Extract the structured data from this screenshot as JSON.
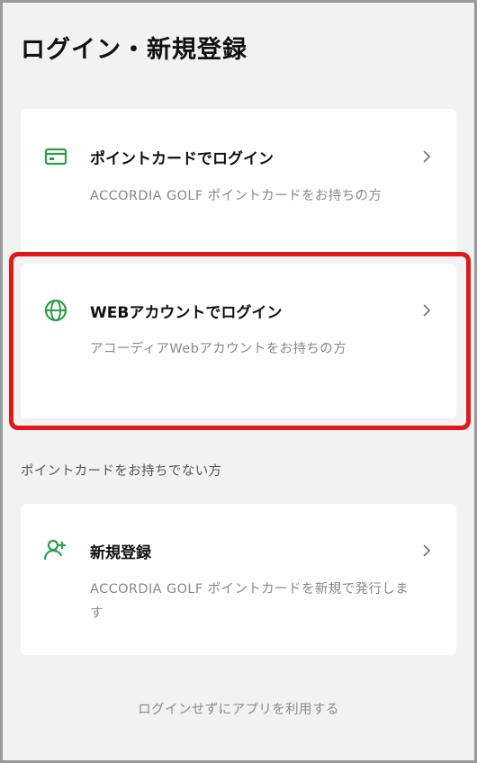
{
  "page": {
    "title": "ログイン・新規登録"
  },
  "point_card": {
    "title": "ポイントカードでログイン",
    "description": "ACCORDIA GOLF ポイントカードをお持ちの方",
    "icon": "card-icon"
  },
  "web_account": {
    "title": "WEBアカウントでログイン",
    "description": "アコーディアWebアカウントをお持ちの方",
    "icon": "globe-icon"
  },
  "section": {
    "label": "ポイントカードをお持ちでない方"
  },
  "new_registration": {
    "title": "新規登録",
    "description": "ACCORDIA GOLF ポイントカードを新規で発行します",
    "icon": "add-user-icon"
  },
  "footer": {
    "skip_label": "ログインせずにアプリを利用する"
  },
  "colors": {
    "accent": "#2e9e4a",
    "highlight": "#e01818"
  }
}
